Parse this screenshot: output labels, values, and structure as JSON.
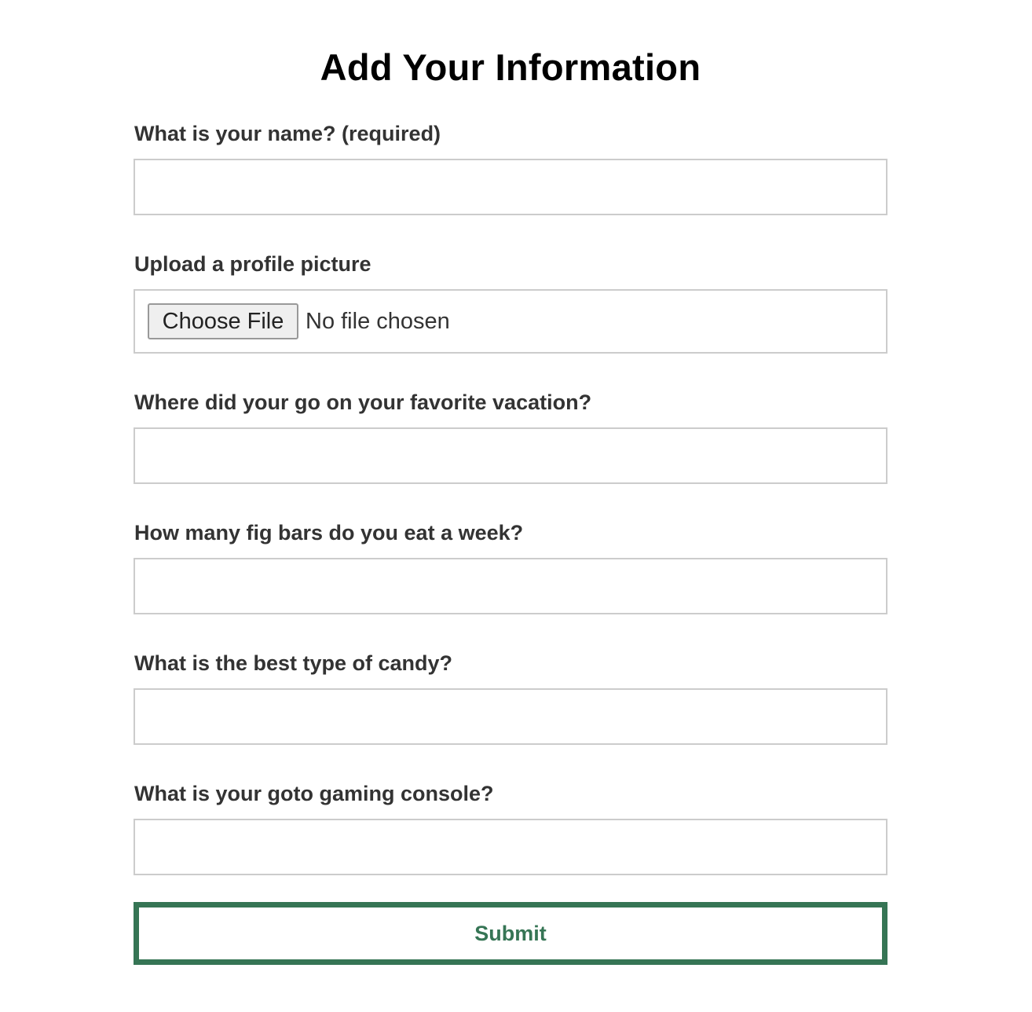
{
  "page": {
    "title": "Add Your Information"
  },
  "form": {
    "name_label": "What is your name? (required)",
    "picture_label": "Upload a profile picture",
    "file_button_label": "Choose File",
    "file_status": "No file chosen",
    "vacation_label": "Where did your go on your favorite vacation?",
    "figbars_label": "How many fig bars do you eat a week?",
    "candy_label": "What is the best type of candy?",
    "console_label": "What is your goto gaming console?",
    "name_value": "",
    "vacation_value": "",
    "figbars_value": "",
    "candy_value": "",
    "console_value": "",
    "submit_label": "Submit"
  },
  "colors": {
    "accent": "#367555",
    "border": "#cccccc",
    "label": "#333333"
  }
}
